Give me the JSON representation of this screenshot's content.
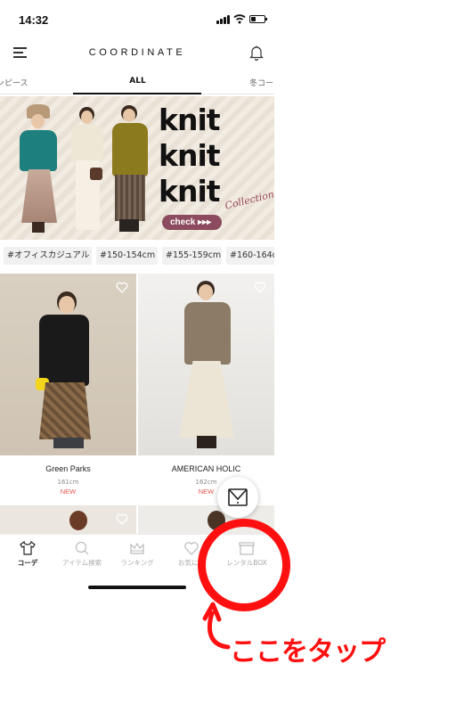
{
  "status_bar": {
    "time": "14:32",
    "battery_level": 0.35
  },
  "header": {
    "title": "COORDINATE",
    "menu_icon": "hamburger-menu-icon",
    "bell_icon": "bell-icon"
  },
  "tabs": [
    {
      "label": "ンピース",
      "active": false
    },
    {
      "label": "ALL",
      "active": true
    },
    {
      "label": "冬コー",
      "active": false
    }
  ],
  "banner": {
    "headline_lines": [
      "knit",
      "knit",
      "knit"
    ],
    "script_text": "Collection",
    "button_label": "check ▸▸▸",
    "colors": {
      "background": "#efe8de",
      "button": "#8c4b5f"
    }
  },
  "hashtags": [
    "#オフィスカジュアル",
    "#150-154cm",
    "#155-159cm",
    "#160-164c"
  ],
  "products": [
    {
      "brand": "Green Parks",
      "height": "161cm",
      "badge": "NEW"
    },
    {
      "brand": "AMERICAN HOLIC",
      "height": "162cm",
      "badge": "NEW"
    }
  ],
  "bottom_nav": [
    {
      "label": "コーデ",
      "icon": "tshirt-icon",
      "active": true
    },
    {
      "label": "アイテム検索",
      "icon": "search-icon",
      "active": false
    },
    {
      "label": "ランキング",
      "icon": "crown-icon",
      "active": false
    },
    {
      "label": "お気に入",
      "icon": "heart-icon",
      "active": false
    },
    {
      "label": "レンタルBOX",
      "icon": "box-icon",
      "active": false
    }
  ],
  "annotation": {
    "text": "ここをタップ",
    "color": "#ff1010"
  }
}
